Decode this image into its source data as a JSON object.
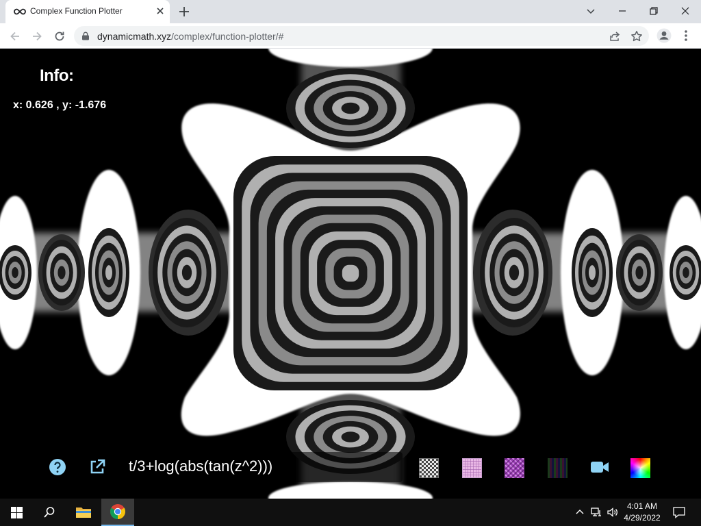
{
  "browser": {
    "tab_title": "Complex Function Plotter",
    "url_host": "dynamicmath.xyz",
    "url_path": "/complex/function-plotter/#"
  },
  "info": {
    "title": "Info:",
    "coords": "x: 0.626 , y: -1.676"
  },
  "plot": {
    "formula": "t/3+log(abs(tan(z^2)))"
  },
  "toolbar_icons": [
    "help-icon",
    "external-link-icon",
    "video-camera-icon",
    "color-wheel-icon"
  ],
  "swatches": [
    "grayscale-checker",
    "pink-grid",
    "purple-pattern",
    "rgb-stripes"
  ],
  "colors": {
    "accent_icon": "#8fd3f5",
    "plot_light": "#ffffff",
    "plot_mid": "#8a8a8a",
    "plot_dark": "#1a1a1a"
  },
  "taskbar": {
    "time": "4:01 AM",
    "date": "4/29/2022"
  }
}
